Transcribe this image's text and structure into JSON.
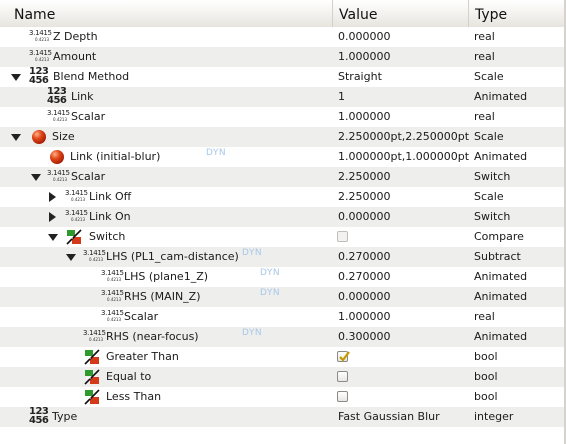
{
  "header": {
    "name": "Name",
    "value": "Value",
    "type": "Type"
  },
  "dyn_label": "DYN",
  "icon_text": {
    "real_main": "3.1415",
    "real_sub": "0.4213",
    "int_top": "123",
    "int_bottom": "456"
  },
  "rows": [
    {
      "name": "Z Depth",
      "value": "0.000000",
      "type": "real",
      "icon": "real-number-icon"
    },
    {
      "name": "Amount",
      "value": "1.000000",
      "type": "real",
      "icon": "real-number-icon"
    },
    {
      "name": "Blend Method",
      "value": "Straight",
      "type": "Scale",
      "icon": "integer-icon",
      "expander": "expanded"
    },
    {
      "name": "Link",
      "value": "1",
      "type": "Animated",
      "icon": "integer-icon"
    },
    {
      "name": "Scalar",
      "value": "1.000000",
      "type": "real",
      "icon": "real-number-icon"
    },
    {
      "name": "Size",
      "value": "2.250000pt,2.250000pt",
      "type": "Scale",
      "icon": "vector-icon",
      "expander": "expanded"
    },
    {
      "name": "Link (initial-blur)",
      "value": "1.000000pt,1.000000pt",
      "type": "Animated",
      "icon": "vector-icon",
      "dyn": true
    },
    {
      "name": "Scalar",
      "value": "2.250000",
      "type": "Switch",
      "icon": "real-number-icon",
      "expander": "expanded"
    },
    {
      "name": "Link Off",
      "value": "2.250000",
      "type": "Scale",
      "icon": "real-number-icon",
      "expander": "collapsed"
    },
    {
      "name": "Link On",
      "value": "0.000000",
      "type": "Switch",
      "icon": "real-number-icon",
      "expander": "collapsed"
    },
    {
      "name": "Switch",
      "value": "",
      "type": "Compare",
      "icon": "bool-icon",
      "expander": "expanded",
      "checkbox": "disabled"
    },
    {
      "name": "LHS (PL1_cam-distance)",
      "value": "0.270000",
      "type": "Subtract",
      "icon": "real-number-icon",
      "expander": "expanded",
      "dyn": true
    },
    {
      "name": "LHS (plane1_Z)",
      "value": "0.270000",
      "type": "Animated",
      "icon": "real-number-icon",
      "dyn": true
    },
    {
      "name": "RHS (MAIN_Z)",
      "value": "0.000000",
      "type": "Animated",
      "icon": "real-number-icon",
      "dyn": true
    },
    {
      "name": "Scalar",
      "value": "1.000000",
      "type": "real",
      "icon": "real-number-icon"
    },
    {
      "name": "RHS (near-focus)",
      "value": "0.300000",
      "type": "Animated",
      "icon": "real-number-icon",
      "dyn": true
    },
    {
      "name": "Greater Than",
      "value": "",
      "type": "bool",
      "icon": "bool-icon",
      "checkbox": "checked"
    },
    {
      "name": "Equal to",
      "value": "",
      "type": "bool",
      "icon": "bool-icon",
      "checkbox": "unchecked"
    },
    {
      "name": "Less Than",
      "value": "",
      "type": "bool",
      "icon": "bool-icon",
      "checkbox": "unchecked"
    },
    {
      "name": "Type",
      "value": "Fast Gaussian Blur",
      "type": "integer",
      "icon": "integer-icon"
    }
  ],
  "colors": {
    "row_alt": "#eeeeec",
    "header_border": "#c4c0b8",
    "dyn": "#a8c8e8",
    "vector": "#d0401a",
    "check": "#c49a00"
  }
}
